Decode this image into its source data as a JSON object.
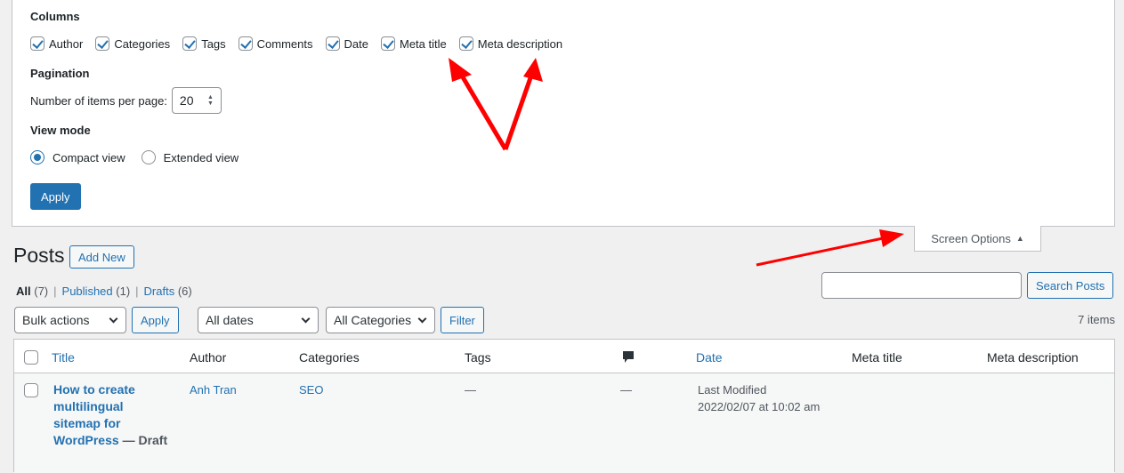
{
  "screen_options": {
    "columns_legend": "Columns",
    "columns": [
      {
        "label": "Author",
        "checked": true
      },
      {
        "label": "Categories",
        "checked": true
      },
      {
        "label": "Tags",
        "checked": true
      },
      {
        "label": "Comments",
        "checked": true
      },
      {
        "label": "Date",
        "checked": true
      },
      {
        "label": "Meta title",
        "checked": true
      },
      {
        "label": "Meta description",
        "checked": true
      }
    ],
    "pagination_legend": "Pagination",
    "per_page_label": "Number of items per page:",
    "per_page_value": "20",
    "view_mode_legend": "View mode",
    "view_modes": [
      {
        "label": "Compact view",
        "selected": true
      },
      {
        "label": "Extended view",
        "selected": false
      }
    ],
    "apply_label": "Apply",
    "tab_label": "Screen Options",
    "tab_icon": "triangle-up-icon"
  },
  "header": {
    "title": "Posts",
    "add_new_label": "Add New"
  },
  "views": [
    {
      "label": "All",
      "count": "(7)",
      "current": true
    },
    {
      "label": "Published",
      "count": "(1)",
      "current": false
    },
    {
      "label": "Drafts",
      "count": "(6)",
      "current": false
    }
  ],
  "search": {
    "value": "",
    "button_label": "Search Posts"
  },
  "filters": {
    "bulk_actions": "Bulk actions",
    "apply_label": "Apply",
    "dates": "All dates",
    "categories": "All Categories",
    "filter_label": "Filter",
    "items_count": "7 items"
  },
  "table": {
    "columns": [
      "Title",
      "Author",
      "Categories",
      "Tags",
      "comments-icon",
      "Date",
      "Meta title",
      "Meta description"
    ],
    "rows": [
      {
        "title_lines": [
          "How to create",
          "multilingual",
          "sitemap for",
          "WordPress"
        ],
        "state": "— Draft",
        "author": "Anh Tran",
        "categories": "SEO",
        "tags": "—",
        "comments": "—",
        "date_status": "Last Modified",
        "date_value": "2022/02/07 at 10:02 am",
        "meta_title": "",
        "meta_description": ""
      }
    ]
  },
  "colors": {
    "accent": "#2271b1",
    "annotation_arrow": "#ff0000",
    "background": "#f0f0f1"
  }
}
